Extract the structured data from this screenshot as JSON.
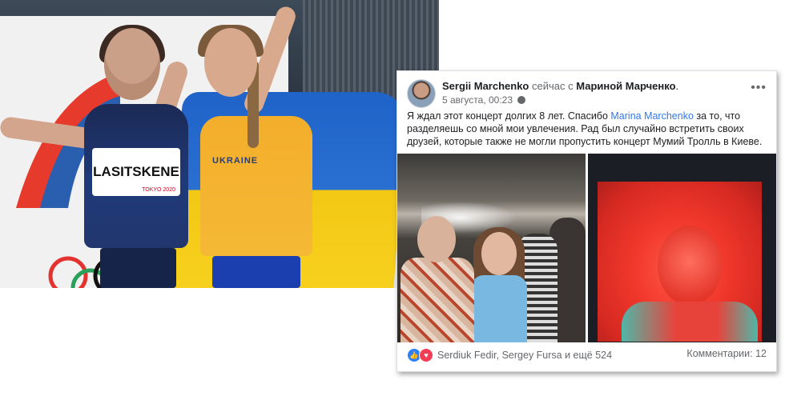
{
  "left_photo": {
    "bib_text": "LASITSKENE",
    "bib_small": "TOKYO 2020",
    "shirt_text": "UKRAINE"
  },
  "post": {
    "author": "Sergii Marchenko",
    "time_word": "сейчас с",
    "tagged": "Мариной Марченко",
    "date": "5 августа, 00:23",
    "more_label": "•••",
    "text": {
      "line1_a": "Я ждал этот концерт долгих 8 лет. Спасибо ",
      "mention": "Marina Marchenko",
      "line1_b": " за то, что",
      "line2": "разделяешь со мной мои увлечения. Рад был случайно встретить своих",
      "line3": "друзей, которые также не могли пропустить концерт Мумий Тролль в  Киеве."
    },
    "reactions": {
      "like_icon": "👍",
      "love_icon": "♥",
      "names": "Serdiuk Fedir, Sergey Fursa и ещё 524"
    },
    "comments": "Комментарии: 12"
  }
}
